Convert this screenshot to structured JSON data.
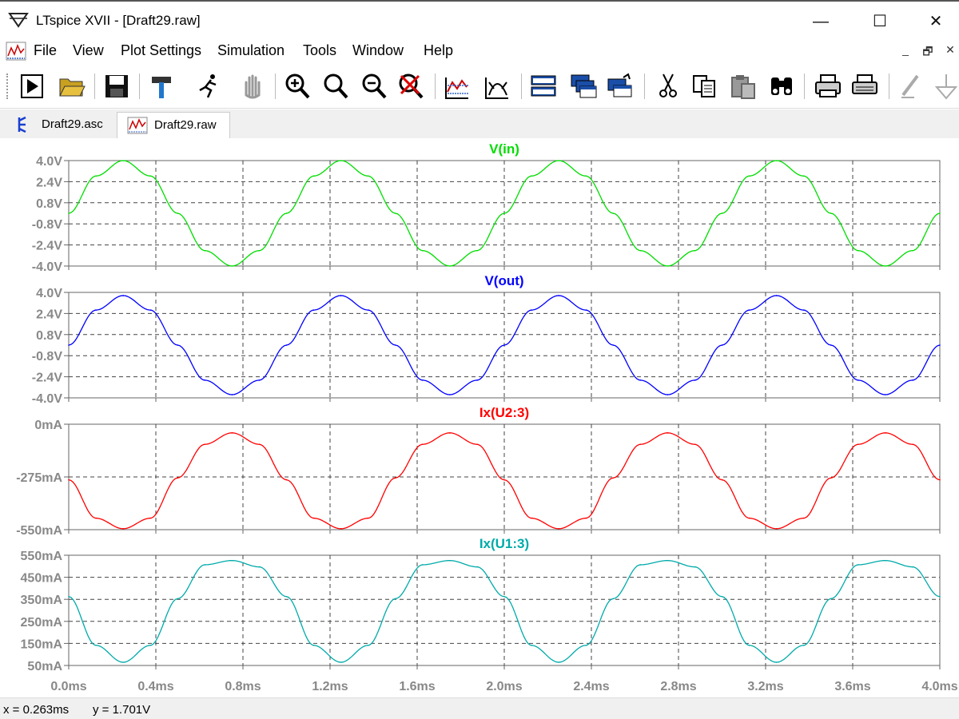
{
  "window": {
    "title": "LTspice XVII - [Draft29.raw]",
    "minimize_label": "—",
    "maximize_label": "☐",
    "close_label": "✕"
  },
  "menu": {
    "items": [
      "File",
      "View",
      "Plot Settings",
      "Simulation",
      "Tools",
      "Window",
      "Help"
    ],
    "mdi_buttons": [
      "_",
      "🗗",
      "✕"
    ]
  },
  "toolbar": {
    "buttons": [
      "run-icon",
      "open-icon",
      "save-icon",
      "control-panel-icon",
      "halt-icon",
      "pan-icon",
      "zoom-in-icon",
      "zoom-area-icon",
      "zoom-out-icon",
      "zoom-cancel-icon",
      "autorange-icon",
      "fft-icon",
      "tile-horizontal-icon",
      "cascade-icon",
      "tile-vertical-icon",
      "cut-icon",
      "copy-icon",
      "paste-icon",
      "find-icon",
      "print-icon",
      "print-setup-icon",
      "label-icon",
      "ground-icon"
    ]
  },
  "tabs": [
    {
      "label": "Draft29.asc",
      "icon": "schematic-icon",
      "active": false
    },
    {
      "label": "Draft29.raw",
      "icon": "waveform-icon",
      "active": true
    }
  ],
  "status": {
    "x_readout": "x = 0.263ms",
    "y_readout": "y = 1.701V"
  },
  "colors": {
    "vin": "#00dd00",
    "vout": "#0000ff",
    "ix_u2": "#ff0000",
    "ix_u1": "#00aaaa",
    "grid": "#444444",
    "axis_text": "#888888"
  },
  "chart_data": [
    {
      "type": "line",
      "title": "V(in)",
      "color": "#00dd00",
      "x_unit": "ms",
      "xlim": [
        0,
        4.0
      ],
      "ylim": [
        -4.0,
        4.0
      ],
      "yticks": [
        "4.0V",
        "2.4V",
        "0.8V",
        "-0.8V",
        "-2.4V",
        "-4.0V"
      ],
      "x": [
        0.0,
        0.125,
        0.25,
        0.375,
        0.5,
        0.625,
        0.75,
        0.875,
        1.0,
        1.125,
        1.25,
        1.375,
        1.5,
        1.625,
        1.75,
        1.875,
        2.0,
        2.125,
        2.25,
        2.375,
        2.5,
        2.625,
        2.75,
        2.875,
        3.0,
        3.125,
        3.25,
        3.375,
        3.5,
        3.625,
        3.75,
        3.875,
        4.0
      ],
      "values": [
        0.0,
        2.83,
        4.0,
        2.83,
        0.0,
        -2.83,
        -4.0,
        -2.83,
        0.0,
        2.83,
        4.0,
        2.83,
        0.0,
        -2.83,
        -4.0,
        -2.83,
        0.0,
        2.83,
        4.0,
        2.83,
        0.0,
        -2.83,
        -4.0,
        -2.83,
        0.0,
        2.83,
        4.0,
        2.83,
        0.0,
        -2.83,
        -4.0,
        -2.83,
        0.0
      ]
    },
    {
      "type": "line",
      "title": "V(out)",
      "color": "#0000ff",
      "x_unit": "ms",
      "xlim": [
        0,
        4.0
      ],
      "ylim": [
        -4.0,
        4.0
      ],
      "yticks": [
        "4.0V",
        "2.4V",
        "0.8V",
        "-0.8V",
        "-2.4V",
        "-4.0V"
      ],
      "x": [
        0.0,
        0.125,
        0.25,
        0.375,
        0.5,
        0.625,
        0.75,
        0.875,
        1.0,
        1.125,
        1.25,
        1.375,
        1.5,
        1.625,
        1.75,
        1.875,
        2.0,
        2.125,
        2.25,
        2.375,
        2.5,
        2.625,
        2.75,
        2.875,
        3.0,
        3.125,
        3.25,
        3.375,
        3.5,
        3.625,
        3.75,
        3.875,
        4.0
      ],
      "values": [
        0.0,
        2.66,
        3.76,
        2.66,
        0.0,
        -2.66,
        -3.76,
        -2.66,
        0.0,
        2.66,
        3.76,
        2.66,
        0.0,
        -2.66,
        -3.76,
        -2.66,
        0.0,
        2.66,
        3.76,
        2.66,
        0.0,
        -2.66,
        -3.76,
        -2.66,
        0.0,
        2.66,
        3.76,
        2.66,
        0.0,
        -2.66,
        -3.76,
        -2.66,
        0.0
      ]
    },
    {
      "type": "line",
      "title": "Ix(U2:3)",
      "color": "#ff0000",
      "x_unit": "ms",
      "xlim": [
        0,
        4.0
      ],
      "ylim": [
        -550,
        0
      ],
      "yticks": [
        "0mA",
        "-275mA",
        "-550mA"
      ],
      "x": [
        0.0,
        0.125,
        0.25,
        0.375,
        0.5,
        0.625,
        0.75,
        0.875,
        1.0,
        1.125,
        1.25,
        1.375,
        1.5,
        1.625,
        1.75,
        1.875,
        2.0,
        2.125,
        2.25,
        2.375,
        2.5,
        2.625,
        2.75,
        2.875,
        3.0,
        3.125,
        3.25,
        3.375,
        3.5,
        3.625,
        3.75,
        3.875,
        4.0
      ],
      "values": [
        -290,
        -490,
        -545,
        -490,
        -280,
        -105,
        -45,
        -105,
        -290,
        -490,
        -545,
        -490,
        -280,
        -105,
        -45,
        -105,
        -290,
        -490,
        -545,
        -490,
        -280,
        -105,
        -45,
        -105,
        -290,
        -490,
        -545,
        -490,
        -280,
        -105,
        -45,
        -105,
        -290
      ]
    },
    {
      "type": "line",
      "title": "Ix(U1:3)",
      "color": "#00aaaa",
      "x_unit": "ms",
      "xlim": [
        0,
        4.0
      ],
      "ylim": [
        45,
        565
      ],
      "yticks": [
        "550mA",
        "450mA",
        "350mA",
        "250mA",
        "150mA",
        "50mA"
      ],
      "xticks": [
        "0.0ms",
        "0.4ms",
        "0.8ms",
        "1.2ms",
        "1.6ms",
        "2.0ms",
        "2.4ms",
        "2.8ms",
        "3.2ms",
        "3.6ms",
        "4.0ms"
      ],
      "x": [
        0.0,
        0.125,
        0.25,
        0.375,
        0.5,
        0.625,
        0.75,
        0.875,
        1.0,
        1.125,
        1.25,
        1.375,
        1.5,
        1.625,
        1.75,
        1.875,
        2.0,
        2.125,
        2.25,
        2.375,
        2.5,
        2.625,
        2.75,
        2.875,
        3.0,
        3.125,
        3.25,
        3.375,
        3.5,
        3.625,
        3.75,
        3.875,
        4.0
      ],
      "values": [
        370,
        140,
        60,
        140,
        360,
        520,
        540,
        510,
        370,
        140,
        60,
        140,
        360,
        520,
        540,
        510,
        370,
        140,
        60,
        140,
        360,
        520,
        540,
        510,
        370,
        140,
        60,
        140,
        360,
        520,
        540,
        510,
        370
      ]
    }
  ]
}
